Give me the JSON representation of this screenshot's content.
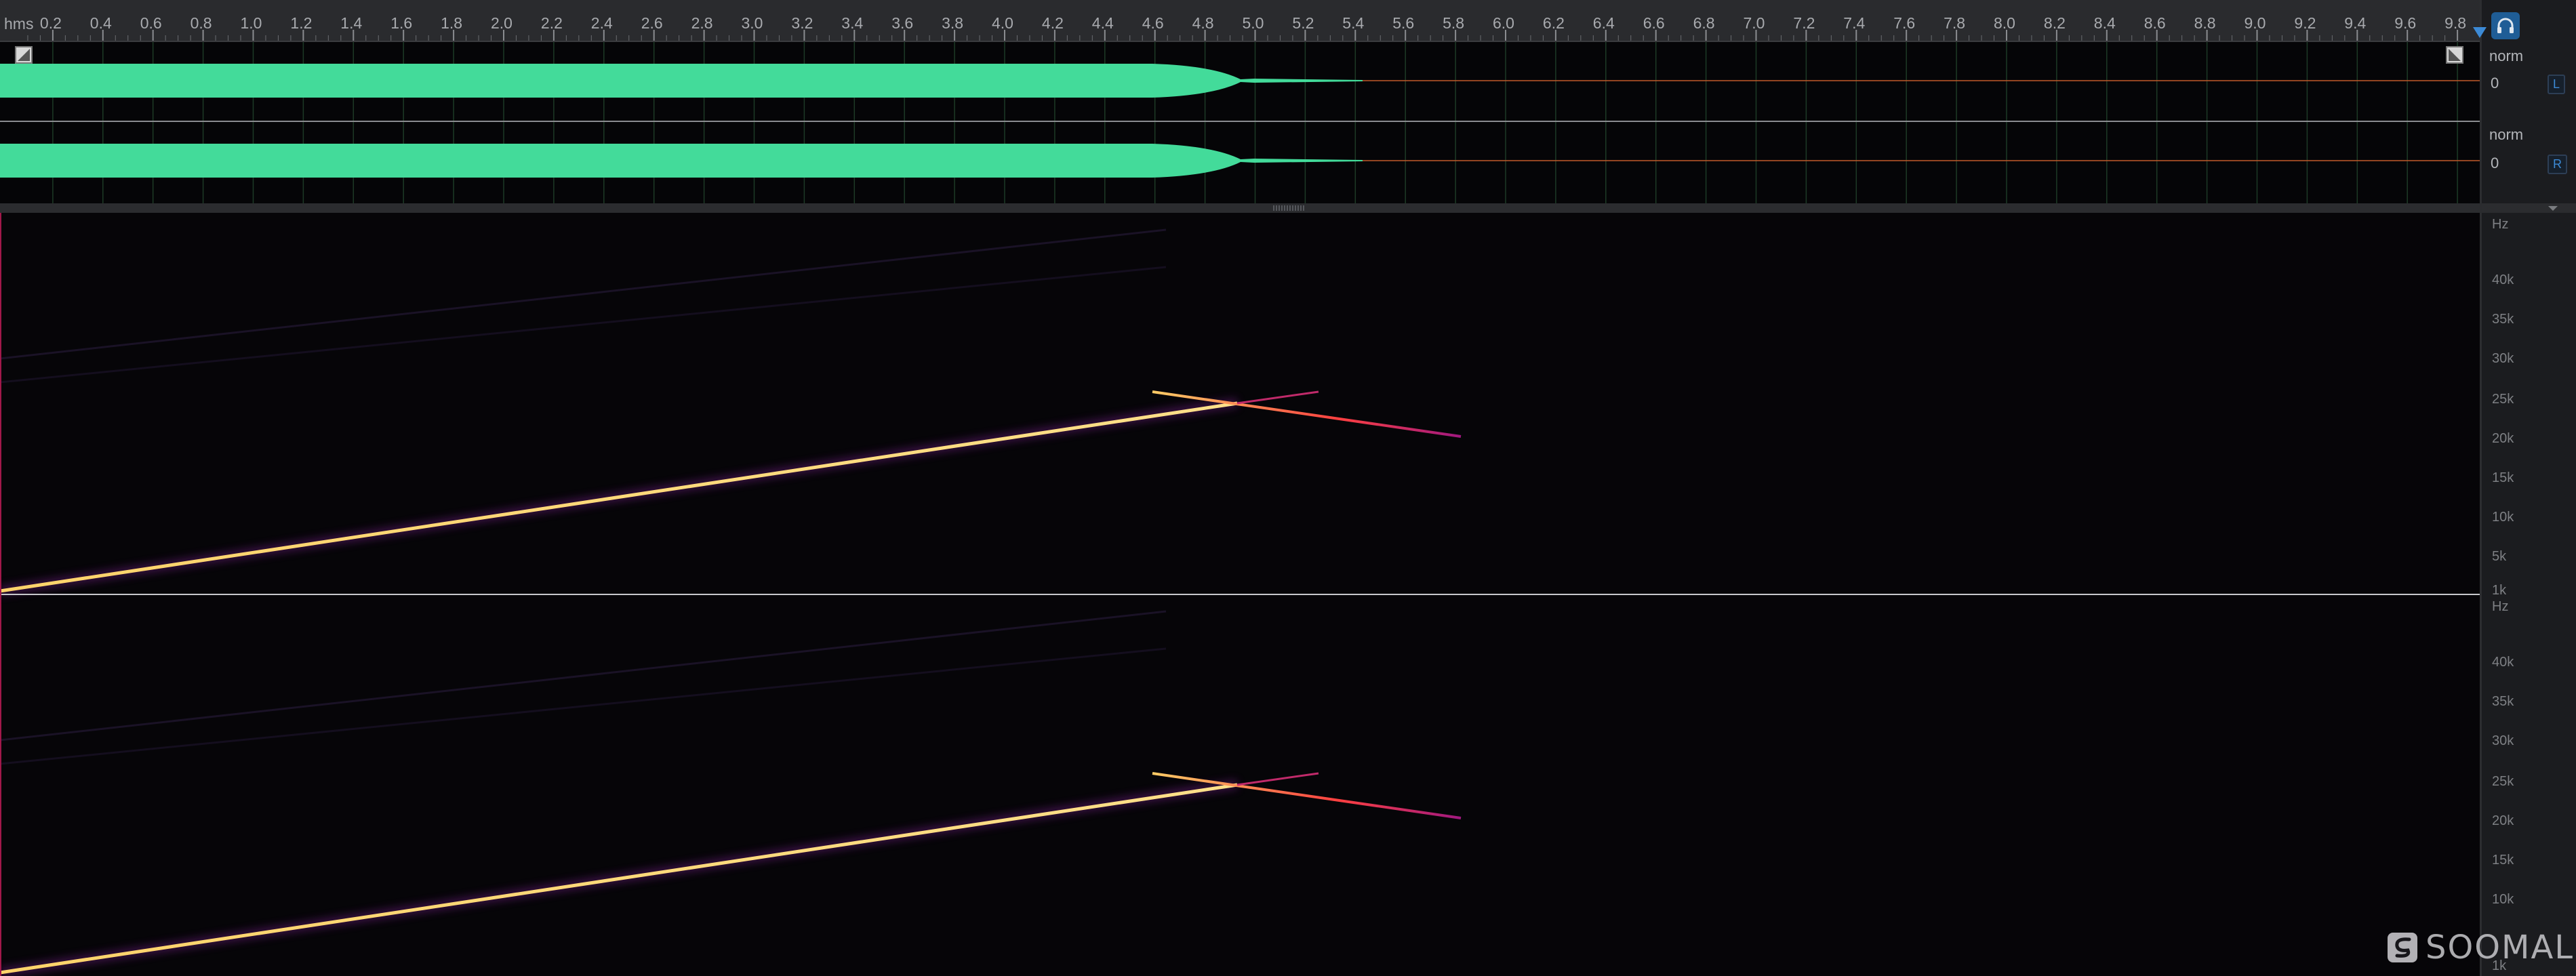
{
  "ruler": {
    "unit": "hms",
    "ticks": [
      "0.2",
      "0.4",
      "0.6",
      "0.8",
      "1.0",
      "1.2",
      "1.4",
      "1.6",
      "1.8",
      "2.0",
      "2.2",
      "2.4",
      "2.6",
      "2.8",
      "3.0",
      "3.2",
      "3.4",
      "3.6",
      "3.8",
      "4.0",
      "4.2",
      "4.4",
      "4.6",
      "4.8",
      "5.0",
      "5.2",
      "5.4",
      "5.6",
      "5.8",
      "6.0",
      "6.2",
      "6.4",
      "6.6",
      "6.8",
      "7.0",
      "7.2",
      "7.4",
      "7.6",
      "7.8",
      "8.0",
      "8.2",
      "8.4",
      "8.6",
      "8.8",
      "9.0",
      "9.2",
      "9.4",
      "9.6",
      "9.8"
    ]
  },
  "waveform": {
    "color": "#43db9a",
    "channels": [
      {
        "scale_label": "norm",
        "zero_label": "0",
        "channel_badge": "L"
      },
      {
        "scale_label": "norm",
        "zero_label": "0",
        "channel_badge": "R"
      }
    ]
  },
  "spectrogram": {
    "unit_label": "Hz",
    "freq_labels": [
      "40k",
      "35k",
      "30k",
      "25k",
      "20k",
      "15k",
      "10k",
      "5k",
      "1k"
    ]
  },
  "icons": {
    "headphones": "headphones-icon",
    "selection_start": "selection-start-icon",
    "selection_end": "selection-end-icon",
    "collapse": "chevron-down-icon",
    "playhead": "playhead-marker-icon"
  },
  "watermark": {
    "text": "SOOMAL"
  }
}
